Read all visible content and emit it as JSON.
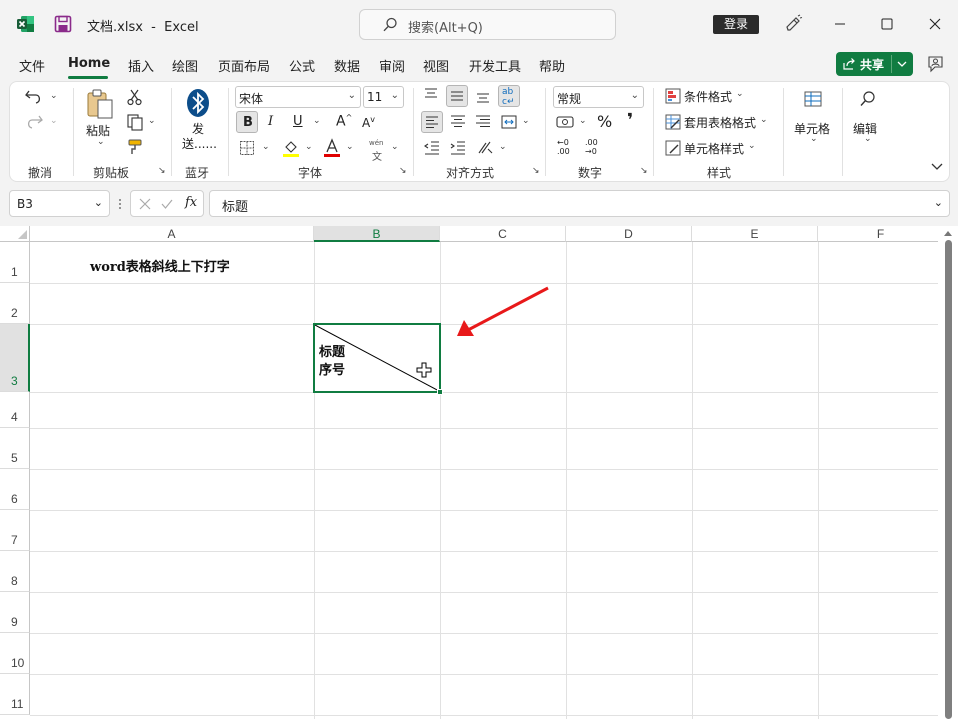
{
  "titlebar": {
    "filename": "文档.xlsx",
    "separator": "-",
    "app": "Excel",
    "search_placeholder": "搜索(Alt+Q)",
    "login_label": "登录"
  },
  "tabs": [
    "文件",
    "Home",
    "插入",
    "绘图",
    "页面布局",
    "公式",
    "数据",
    "审阅",
    "视图",
    "开发工具",
    "帮助"
  ],
  "share_label": "共享",
  "ribbon": {
    "groups": {
      "undo": "撤消",
      "clipboard": "剪贴板",
      "bluetooth": "蓝牙",
      "font": "字体",
      "align": "对齐方式",
      "number": "数字",
      "styles": "样式"
    },
    "paste_label": "粘贴",
    "send_label_1": "发",
    "send_label_2": "送......",
    "font_name": "宋体",
    "font_size": "11",
    "bold": "B",
    "italic": "I",
    "underline": "U",
    "wen_top": "wén",
    "wen_bottom": "文",
    "number_format": "常规",
    "percent": "%",
    "comma": "❜",
    "conditional_format": "条件格式",
    "table_format": "套用表格格式",
    "cell_style": "单元格样式",
    "cells_label": "单元格",
    "edit_label": "编辑",
    "dec_inc_1": "←0",
    "dec_inc_2": ".00",
    "dec_dec_1": ".00",
    "dec_dec_2": "→0"
  },
  "formula_bar": {
    "name_box": "B3",
    "fx": "fx",
    "content": "标题"
  },
  "grid": {
    "columns": [
      "A",
      "B",
      "C",
      "D",
      "E",
      "F"
    ],
    "rows": [
      "1",
      "2",
      "3",
      "4",
      "5",
      "6",
      "7",
      "8",
      "9",
      "10",
      "11"
    ],
    "selected_cell": "B3",
    "a1_text": "word表格斜线上下打字",
    "b3_line1": "标题",
    "b3_line2": "序号"
  },
  "colors": {
    "accent": "#107c41",
    "arrow": "#e8191a"
  }
}
